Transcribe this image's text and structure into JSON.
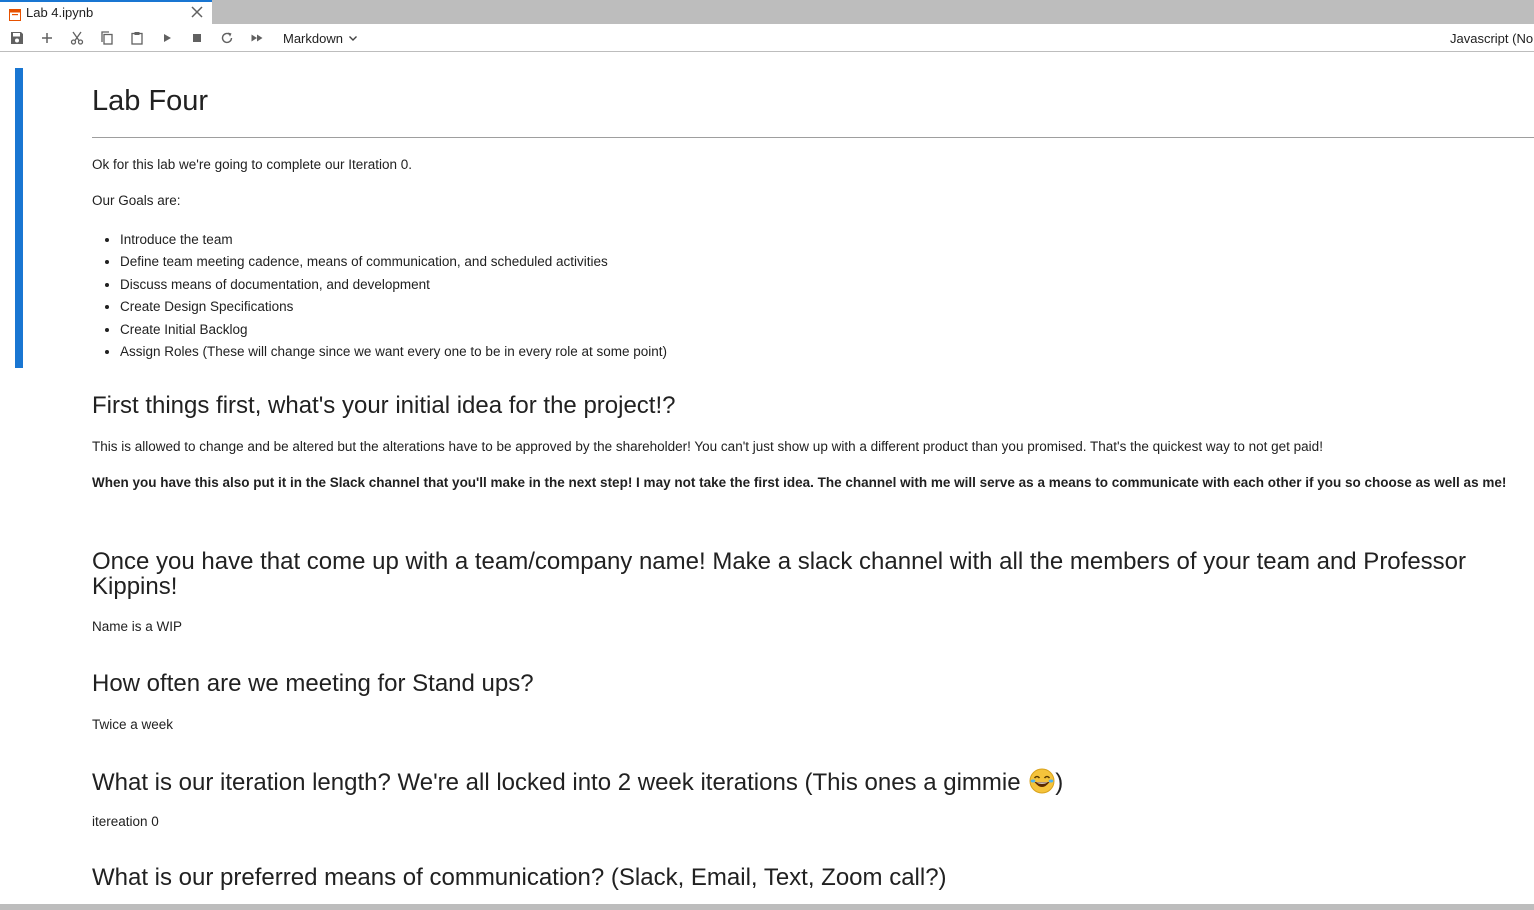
{
  "tab": {
    "label": "Lab 4.ipynb"
  },
  "toolbar": {
    "buttons": [
      "save-icon",
      "add-cell-icon",
      "cut-icon",
      "copy-icon",
      "paste-icon",
      "run-icon",
      "stop-icon",
      "restart-icon",
      "run-all-icon"
    ],
    "cell_type": "Markdown",
    "kernel": "Javascript (No"
  },
  "notebook": {
    "title": "Lab Four",
    "intro": "Ok for this lab we're going to complete our Iteration 0.",
    "goals_label": "Our Goals are:",
    "goals": [
      "Introduce the team",
      "Define team meeting cadence, means of communication, and scheduled activities",
      "Discuss means of documentation, and development",
      "Create Design Specifications",
      "Create Initial Backlog",
      "Assign Roles (These will change since we want every one to be in every role at some point)"
    ],
    "h_idea": "First things first, what's your initial idea for the project!?",
    "p_idea": "This is allowed to change and be altered but the alterations have to be approved by the shareholder! You can't just show up with a different product than you promised. That's the quickest way to not get paid!",
    "p_idea_bold": "When you have this also put it in the Slack channel that you'll make in the next step! I may not take the first idea. The channel with me will serve as a means to communicate with each other if you so choose as well as me!",
    "h_name": "Once you have that come up with a team/company name! Make a slack channel with all the members of your team and Professor Kippins!",
    "p_name": "Name is a WIP",
    "h_standup": "How often are we meeting for Stand ups?",
    "p_standup": "Twice a week",
    "h_iteration": "What is our iteration length? We're all locked into 2 week iterations (This ones a gimmie",
    "h_iteration_end": ")",
    "p_iteration": "itereation 0",
    "h_comm": "What is our preferred means of communication? (Slack, Email, Text, Zoom call?)"
  },
  "colors": {
    "accent": "#1976d2",
    "tab_bar": "#bdbdbd",
    "text": "#212121"
  }
}
